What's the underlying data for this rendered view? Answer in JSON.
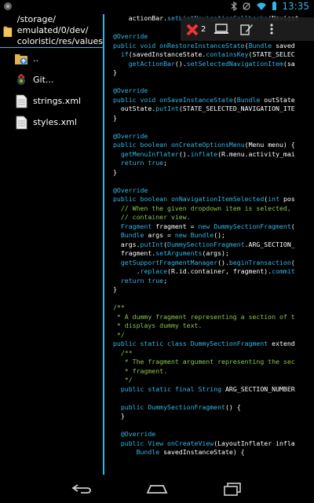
{
  "status": {
    "time": "13:35"
  },
  "sidebar": {
    "path": "/storage/\nemulated/0/dev/\ncoloristic/res/values",
    "items": [
      {
        "label": "..",
        "icon": "folder-up-icon"
      },
      {
        "label": "Git...",
        "icon": "git-icon"
      },
      {
        "label": "strings.xml",
        "icon": "document-icon"
      },
      {
        "label": "styles.xml",
        "icon": "document-icon"
      }
    ]
  },
  "toolbar": {
    "error_count": "2",
    "icons": [
      "error-icon",
      "laptop-icon",
      "edit-icon",
      "overflow-menu-icon"
    ]
  },
  "code_lines": [
    "    actionBar.setListNavigationCallbacks(Navigat",
    "",
    "@Override",
    "public void onRestoreInstanceState(Bundle saved",
    "  if(savedInstanceState.containsKey(STATE_SELEC",
    "    getActionBar().setSelectedNavigationItem(sa",
    "}",
    "",
    "@Override",
    "public void onSaveInstanceState(Bundle outState",
    "  outState.putInt(STATE_SELECTED_NAVIGATION_ITE",
    "}",
    "",
    "@Override",
    "public boolean onCreateOptionsMenu(Menu menu) {",
    "  getMenuInflater().inflate(R.menu.activity_mai",
    "  return true;",
    "}",
    "",
    "@Override",
    "public boolean onNavigationItemSelected(int pos",
    "  // When the given dropdown item is selected,",
    "  // container view.",
    "  Fragment fragment = new DummySectionFragment(",
    "  Bundle args = new Bundle();",
    "  args.putInt(DummySectionFragment.ARG_SECTION_",
    "  fragment.setArguments(args);",
    "  getSupportFragmentManager().beginTransaction(",
    "      .replace(R.id.container, fragment).commit",
    "  return true;",
    "}",
    "",
    "/**",
    " * A dummy fragment representing a section of t",
    " * displays dummy text.",
    " */",
    "public static class DummySectionFragment extend",
    "  /**",
    "   * The fragment argument representing the sec",
    "   * fragment.",
    "   */",
    "  public static final String ARG_SECTION_NUMBER",
    "",
    "  public DummySectionFragment() {",
    "  }",
    "",
    "  @Override",
    "  public View onCreateView(LayoutInflater infla",
    "      Bundle savedInstanceState) {"
  ],
  "navbar": {
    "icons": [
      "back-icon",
      "home-icon",
      "recents-icon"
    ]
  },
  "colors": {
    "accent": "#33b5e5",
    "comment": "#8bc34a"
  }
}
